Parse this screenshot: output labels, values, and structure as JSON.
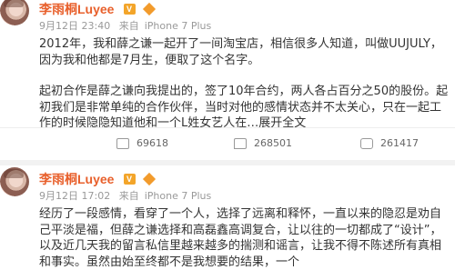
{
  "posts": [
    {
      "username": "李雨桐Luyee",
      "badge": "V",
      "timeline": {
        "date": "9月12日 23:40",
        "source_prefix": "来自",
        "source": "iPhone 7 Plus"
      },
      "paragraphs": [
        "2012年，我和薛之谦一起开了一间淘宝店，相信很多人知道，叫做UUJULY，因为我和他都是7月生，便取了这个名字。",
        "",
        "起初合作是薛之谦向我提出的，签了10年合约，两人各占百分之50的股份。起初我们是非常单纯的合作伙伴，当时对他的感情状态并不太关心，只在一起工作的时候隐隐知道他和一个L姓女艺人在…"
      ],
      "expand_label": "展开全文",
      "actions": {
        "repost": "69618",
        "comment": "268501",
        "like": "261417"
      }
    },
    {
      "username": "李雨桐Luyee",
      "badge": "V",
      "timeline": {
        "date": "9月12日 17:02",
        "source_prefix": "来自",
        "source": "iPhone 7 Plus"
      },
      "paragraphs": [
        "经历了一段感情，看穿了一个人，选择了远离和释怀，一直以来的隐忍是劝自己平淡是福，但薛之谦选择和高磊鑫高调复合，让以往的一切都成了“设计”，以及近几天我的留言私信里越来越多的揣测和谣言，让我不得不陈述所有真相和事实。虽然由始至终都不是我想要的结果，一个"
      ]
    }
  ]
}
